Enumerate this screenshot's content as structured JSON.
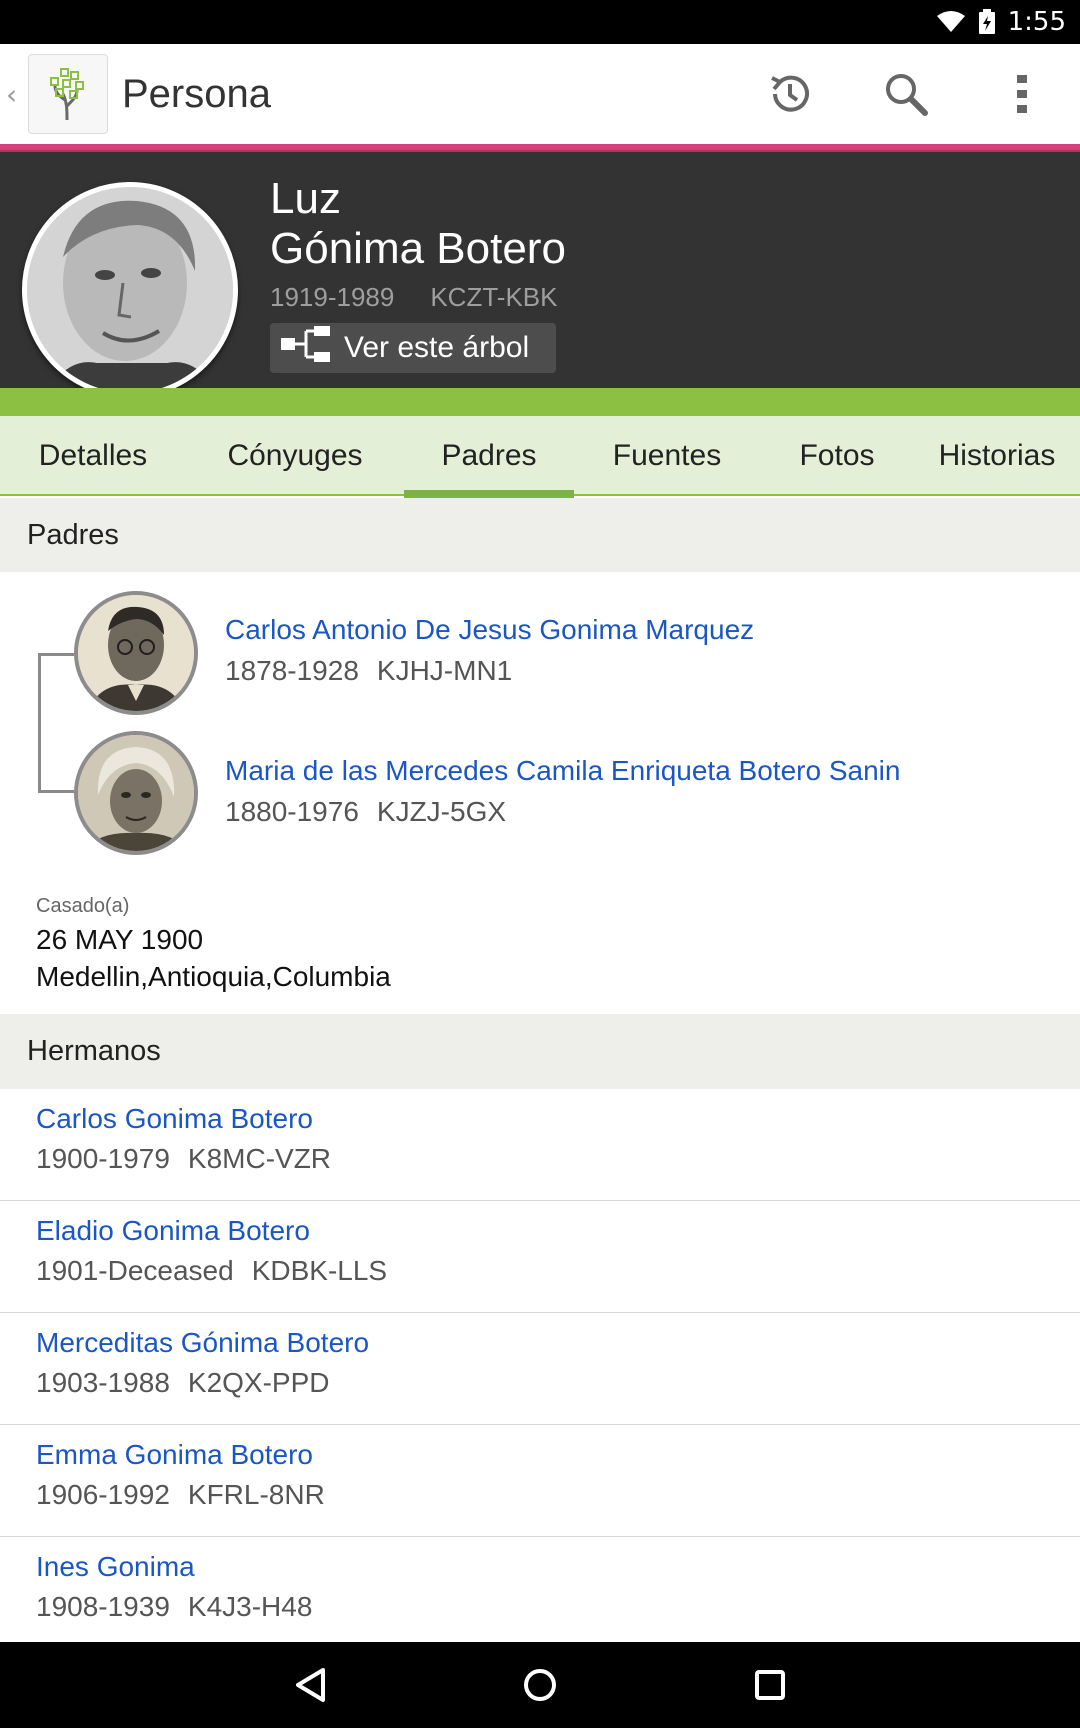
{
  "status_bar": {
    "time": "1:55"
  },
  "app_bar": {
    "title": "Persona"
  },
  "person": {
    "given_name": "Luz",
    "surname": "Gónima Botero",
    "lifespan": "1919-1989",
    "id": "KCZT-KBK",
    "tree_button_label": "Ver este árbol"
  },
  "tabs": [
    {
      "label": "Detalles"
    },
    {
      "label": "Cónyuges"
    },
    {
      "label": "Padres"
    },
    {
      "label": "Fuentes"
    },
    {
      "label": "Fotos"
    },
    {
      "label": "Historias"
    }
  ],
  "active_tab": "Padres",
  "parents_section": {
    "header": "Padres",
    "parents": [
      {
        "name": "Carlos Antonio De Jesus Gonima Marquez",
        "lifespan": "1878-1928",
        "id": "KJHJ-MN1"
      },
      {
        "name": "Maria de las Mercedes Camila Enriqueta Botero Sanin",
        "lifespan": "1880-1976",
        "id": "KJZJ-5GX"
      }
    ],
    "marriage": {
      "label": "Casado(a)",
      "date": "26 MAY 1900",
      "place": "Medellin,Antioquia,Columbia"
    }
  },
  "siblings_section": {
    "header": "Hermanos",
    "siblings": [
      {
        "name": "Carlos Gonima Botero",
        "lifespan": "1900-1979",
        "id": "K8MC-VZR"
      },
      {
        "name": "Eladio Gonima Botero",
        "lifespan": "1901-Deceased",
        "id": "KDBK-LLS"
      },
      {
        "name": "Merceditas Gónima Botero",
        "lifespan": "1903-1988",
        "id": "K2QX-PPD"
      },
      {
        "name": "Emma Gonima Botero",
        "lifespan": "1906-1992",
        "id": "KFRL-8NR"
      },
      {
        "name": "Ines Gonima",
        "lifespan": "1908-1939",
        "id": "K4J3-H48"
      }
    ]
  },
  "colors": {
    "accent_pink": "#d6417a",
    "accent_green": "#8bc043",
    "link_blue": "#1a57c4",
    "hero_bg": "#333333"
  },
  "icons": {
    "app_logo": "familytree-logo-icon",
    "history": "history-icon",
    "search": "search-icon",
    "overflow": "more-vert-icon",
    "tree": "pedigree-tree-icon",
    "nav_back": "nav-back-icon",
    "nav_home": "nav-home-icon",
    "nav_recents": "nav-recents-icon"
  }
}
